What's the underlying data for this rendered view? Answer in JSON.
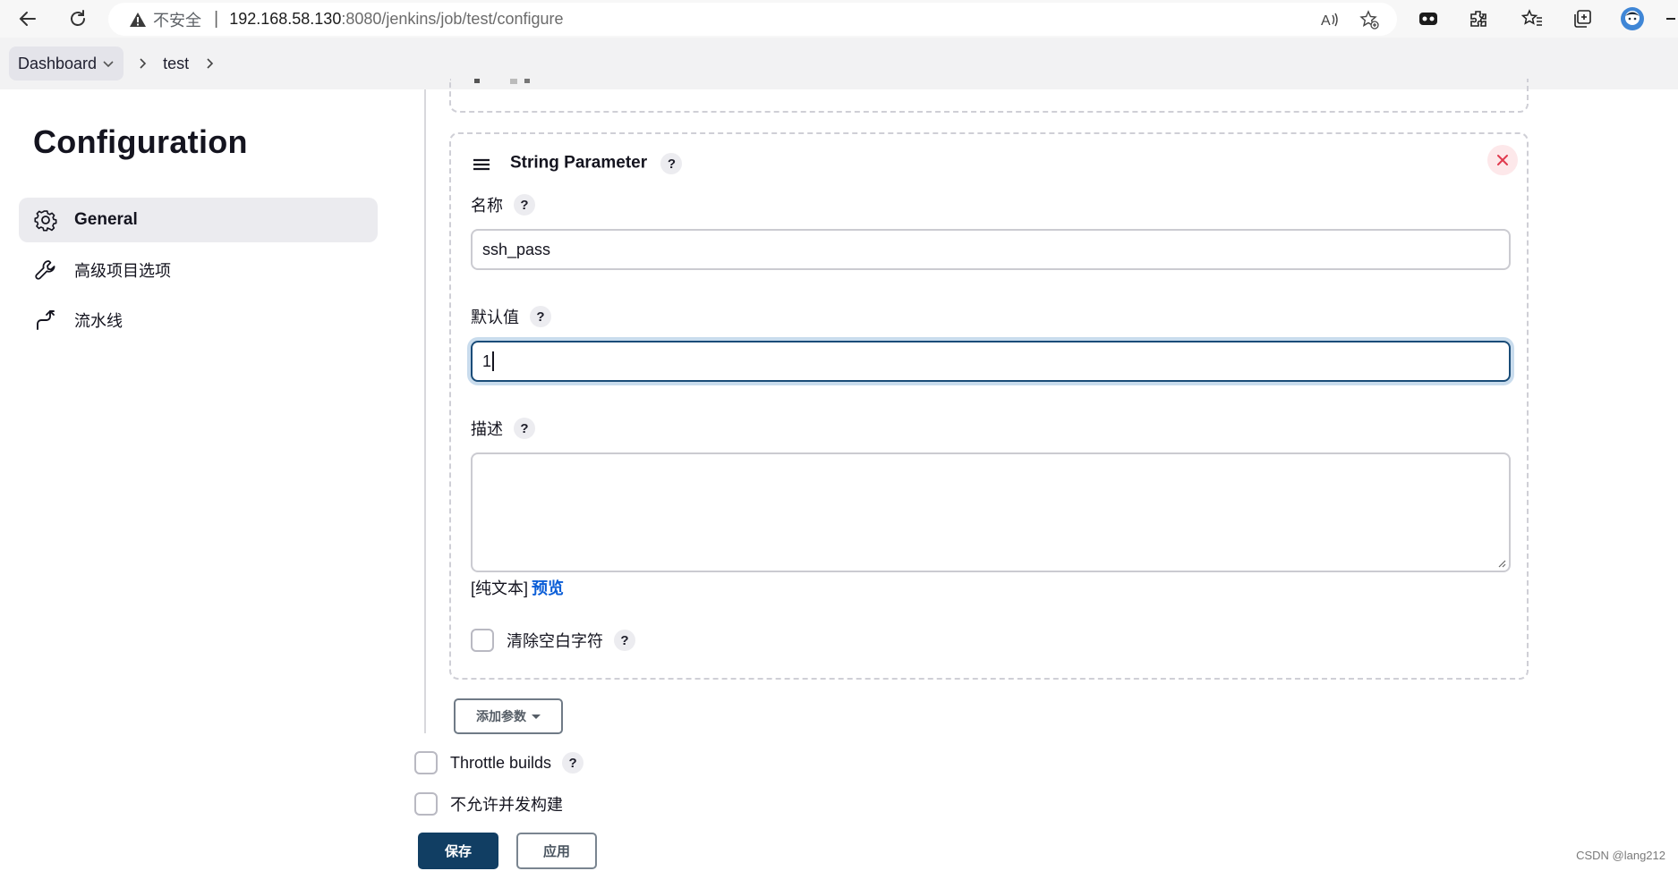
{
  "browser": {
    "insecure_label": "不安全",
    "url_host": "192.168.58.130",
    "url_path": ":8080/jenkins/job/test/configure"
  },
  "breadcrumb": {
    "items": [
      "Dashboard",
      "test"
    ]
  },
  "sidebar": {
    "title": "Configuration",
    "items": [
      {
        "label": "General",
        "icon": "gear-icon"
      },
      {
        "label": "高级项目选项",
        "icon": "wrench-icon"
      },
      {
        "label": "流水线",
        "icon": "pipeline-icon"
      }
    ]
  },
  "param": {
    "title": "String Parameter",
    "help": "?",
    "name_label": "名称",
    "name_value": "ssh_pass",
    "default_label": "默认值",
    "default_value": "1",
    "desc_label": "描述",
    "desc_value": "",
    "plain_text": "[纯文本]",
    "preview": "预览",
    "trim_label": "清除空白字符"
  },
  "actions": {
    "add_param": "添加参数",
    "throttle_label": "Throttle builds",
    "no_concurrent_label": "不允许并发构建",
    "save": "保存",
    "apply": "应用"
  },
  "watermark": "CSDN @lang212"
}
